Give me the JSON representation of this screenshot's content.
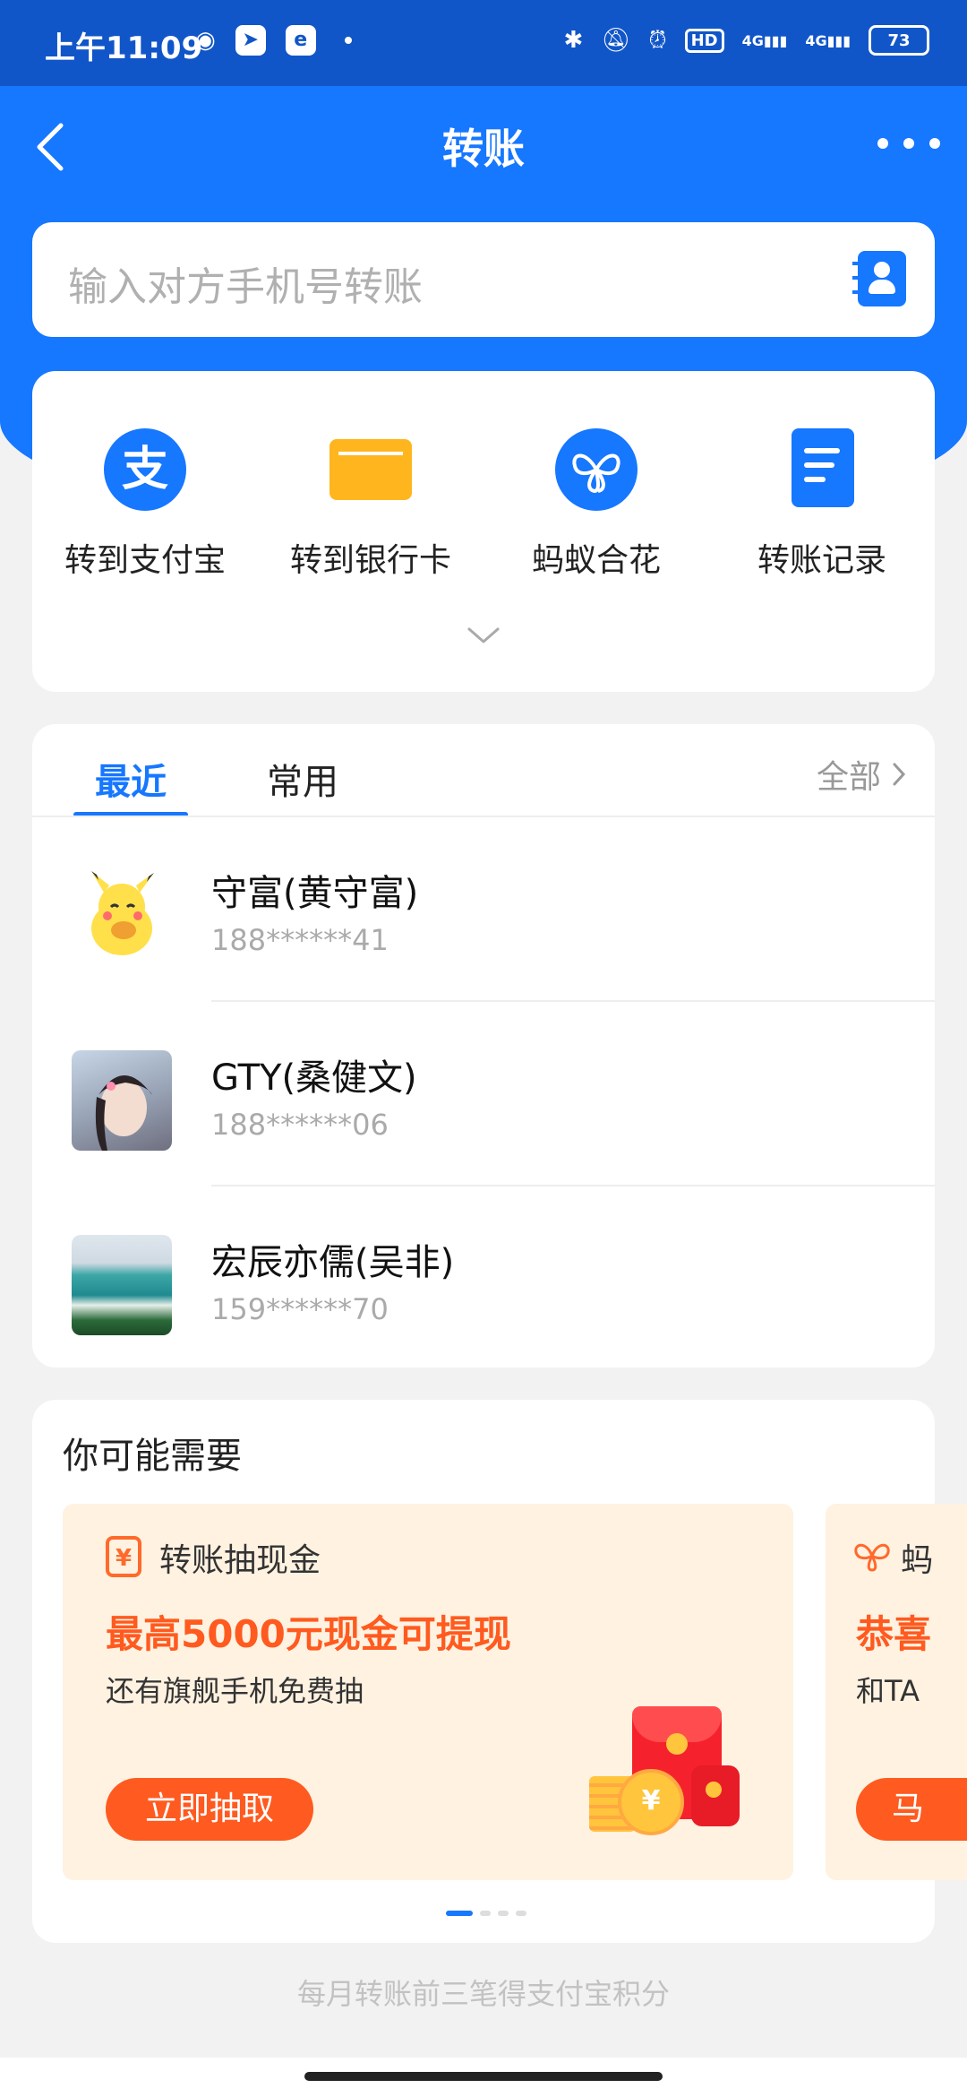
{
  "status_bar": {
    "time": "上午11:09",
    "battery": "73",
    "network": "4G",
    "hd": "HD"
  },
  "nav": {
    "title": "转账"
  },
  "search": {
    "placeholder": "输入对方手机号转账"
  },
  "actions": [
    {
      "label": "转到支付宝",
      "icon": "alipay-icon"
    },
    {
      "label": "转到银行卡",
      "icon": "bank-card-icon"
    },
    {
      "label": "蚂蚁合花",
      "icon": "ant-flower-icon"
    },
    {
      "label": "转账记录",
      "icon": "transfer-record-icon"
    }
  ],
  "recent": {
    "tabs": [
      {
        "label": "最近",
        "active": true
      },
      {
        "label": "常用",
        "active": false
      }
    ],
    "view_all": "全部",
    "contacts": [
      {
        "name": "守富(黄守富)",
        "phone": "188******41"
      },
      {
        "name": "GTY(桑健文)",
        "phone": "188******06"
      },
      {
        "name": "宏辰亦儒(吴非)",
        "phone": "159******70"
      }
    ]
  },
  "suggest": {
    "title": "你可能需要",
    "promos": [
      {
        "name": "转账抽现金",
        "headline": "最高5000元现金可提现",
        "subtitle": "还有旗舰手机免费抽",
        "button": "立即抽取",
        "coin_symbol": "¥",
        "icon_glyph": "¥"
      },
      {
        "name": "蚂",
        "headline": "恭喜",
        "subtitle": "和TA",
        "button": "马"
      }
    ],
    "pager": {
      "count": 4,
      "active": 0
    }
  },
  "footer_note": "每月转账前三笔得支付宝积分",
  "colors": {
    "brand_blue": "#1677ff",
    "status_blue": "#1156c8",
    "promo_orange": "#ff5a1f",
    "promo_bg": "#fff2e1"
  }
}
